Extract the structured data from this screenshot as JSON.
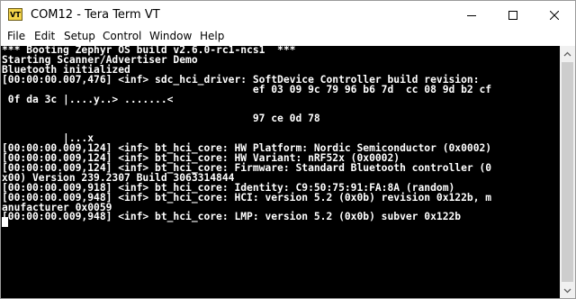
{
  "window": {
    "title": "COM12 - Tera Term VT",
    "icon_label": "VT"
  },
  "menu": {
    "items": [
      "File",
      "Edit",
      "Setup",
      "Control",
      "Window",
      "Help"
    ]
  },
  "terminal": {
    "lines": [
      "*** Booting Zephyr OS build v2.6.0-rc1-ncs1  ***",
      "Starting Scanner/Advertiser Demo",
      "Bluetooth initialized",
      "[00:00:00.007,476] <inf> sdc_hci_driver: SoftDevice Controller build revision:",
      "                                         ef 03 09 9c 79 96 b6 7d  cc 08 9d b2 cf",
      " 0f da 3c |....y..> .......<",
      "",
      "                                         97 ce 0d 78",
      "",
      "          |...x",
      "[00:00:00.009,124] <inf> bt_hci_core: HW Platform: Nordic Semiconductor (0x0002)",
      "[00:00:00.009,124] <inf> bt_hci_core: HW Variant: nRF52x (0x0002)",
      "[00:00:00.009,124] <inf> bt_hci_core: Firmware: Standard Bluetooth controller (0",
      "x00) Version 239.2307 Build 3063314844",
      "[00:00:00.009,918] <inf> bt_hci_core: Identity: C9:50:75:91:FA:8A (random)",
      "[00:00:00.009,948] <inf> bt_hci_core: HCI: version 5.2 (0x0b) revision 0x122b, m",
      "anufacturer 0x0059",
      "[00:00:00.009,948] <inf> bt_hci_core: LMP: version 5.2 (0x0b) subver 0x122b"
    ]
  },
  "icons": {
    "app": "tera-term-app-icon",
    "minimize": "minimize-icon",
    "maximize": "maximize-icon",
    "close": "close-icon",
    "scroll_up": "scroll-up-arrow-icon",
    "scroll_down": "scroll-down-arrow-icon"
  },
  "colors": {
    "terminal_bg": "#000000",
    "terminal_fg": "#ffffff",
    "titlebar_bg": "#ffffff"
  }
}
